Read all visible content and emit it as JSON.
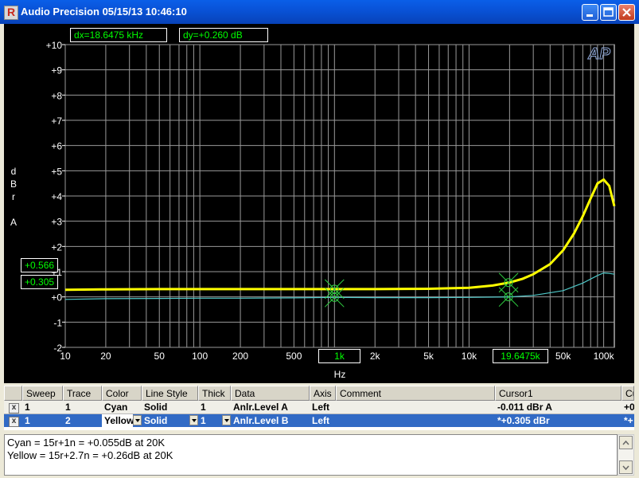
{
  "window": {
    "title": "Audio Precision  05/15/13 10:46:10",
    "buttons": [
      "minimize-icon",
      "maximize-icon",
      "close-icon"
    ]
  },
  "readouts": {
    "dx": "dx=18.6475 kHz",
    "dy": "dy=+0.260  dB",
    "cursor_y1": "+0.566",
    "cursor_y2": "+0.305",
    "cursor_x1": "1k",
    "cursor_x2": "19.6475k"
  },
  "chart_data": {
    "type": "line",
    "title": "",
    "xlabel": "Hz",
    "ylabel": "dBr A",
    "x_scale": "log",
    "xlim": [
      10,
      120000
    ],
    "ylim": [
      -2,
      10
    ],
    "grid": true,
    "logo": "AP",
    "y_ticks": [
      "-2",
      "-1",
      "+0",
      "+1",
      "+2",
      "+3",
      "+4",
      "+5",
      "+6",
      "+7",
      "+8",
      "+9",
      "+10"
    ],
    "y_tick_values": [
      -2,
      -1,
      0,
      1,
      2,
      3,
      4,
      5,
      6,
      7,
      8,
      9,
      10
    ],
    "x_ticks": [
      {
        "label": "10",
        "value": 10
      },
      {
        "label": "20",
        "value": 20
      },
      {
        "label": "50",
        "value": 50
      },
      {
        "label": "100",
        "value": 100
      },
      {
        "label": "200",
        "value": 200
      },
      {
        "label": "500",
        "value": 500
      },
      {
        "label": "2k",
        "value": 2000
      },
      {
        "label": "5k",
        "value": 5000
      },
      {
        "label": "10k",
        "value": 10000
      },
      {
        "label": "50k",
        "value": 50000
      },
      {
        "label": "100k",
        "value": 100000
      }
    ],
    "series": [
      {
        "name": "Cyan",
        "color": "#4fc8c8",
        "x": [
          10,
          20,
          50,
          100,
          200,
          500,
          1000,
          2000,
          5000,
          10000,
          20000,
          30000,
          50000,
          70000,
          90000,
          100000,
          110000,
          120000
        ],
        "y": [
          -0.1,
          -0.07,
          -0.06,
          -0.05,
          -0.05,
          -0.04,
          -0.02,
          -0.03,
          -0.03,
          -0.02,
          0.0,
          0.06,
          0.25,
          0.55,
          0.85,
          0.95,
          0.93,
          0.9
        ]
      },
      {
        "name": "Yellow",
        "color": "#ffff00",
        "x": [
          10,
          20,
          50,
          100,
          200,
          500,
          1000,
          2000,
          5000,
          10000,
          15000,
          20000,
          25000,
          30000,
          40000,
          50000,
          60000,
          70000,
          80000,
          90000,
          100000,
          110000,
          120000
        ],
        "y": [
          0.28,
          0.3,
          0.31,
          0.31,
          0.31,
          0.31,
          0.31,
          0.31,
          0.32,
          0.36,
          0.45,
          0.57,
          0.72,
          0.9,
          1.3,
          1.85,
          2.5,
          3.2,
          3.9,
          4.5,
          4.65,
          4.4,
          3.6
        ]
      }
    ],
    "markers": [
      {
        "series": "Yellow",
        "x": 1000,
        "y": 0.31
      },
      {
        "series": "Yellow",
        "x": 19647.5,
        "y": 0.566
      },
      {
        "series": "Cyan",
        "x": 1000,
        "y": -0.02
      },
      {
        "series": "Cyan",
        "x": 19647.5,
        "y": 0.0
      }
    ]
  },
  "table": {
    "headers": [
      "Sweep",
      "Trace",
      "Color",
      "Line Style",
      "Thick",
      "Data",
      "Axis",
      "Comment",
      "Cursor1",
      "Cu"
    ],
    "rows": [
      {
        "check": "x",
        "sweep": "1",
        "trace": "1",
        "color": "Cyan",
        "style": "Solid",
        "thick": "1",
        "data": "Anlr.Level A",
        "axis": "Left",
        "comment": "",
        "cursor1": "-0.011  dBr A",
        "extra": "+0"
      },
      {
        "check": "x",
        "sweep": "1",
        "trace": "2",
        "color": "Yellow",
        "style": "Solid",
        "thick": "1",
        "data": "Anlr.Level B",
        "axis": "Left",
        "comment": "",
        "cursor1": "*+0.305  dBr",
        "extra": "*+"
      }
    ]
  },
  "notes": [
    "Cyan = 15r+1n = +0.055dB at 20K",
    "Yellow = 15r+2.7n = +0.26dB at 20K"
  ]
}
